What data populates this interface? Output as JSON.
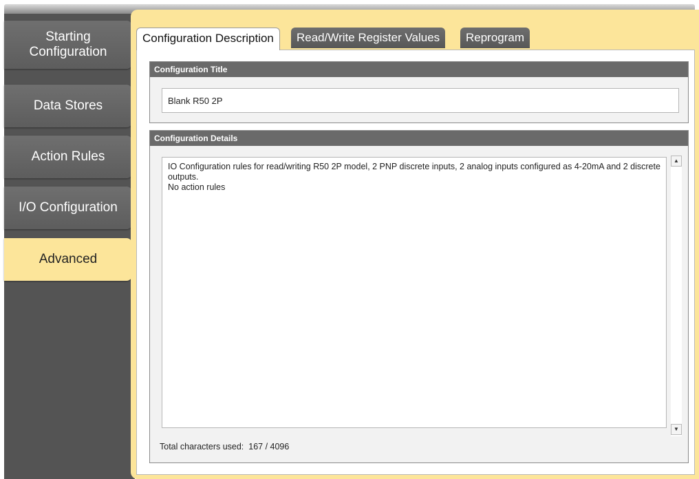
{
  "sidebar": {
    "items": [
      {
        "label": "Starting Configuration",
        "active": false
      },
      {
        "label": "Data Stores",
        "active": false
      },
      {
        "label": "Action Rules",
        "active": false
      },
      {
        "label": "I/O Configuration",
        "active": false
      },
      {
        "label": "Advanced",
        "active": true
      }
    ]
  },
  "tabs": [
    {
      "label": "Configuration Description",
      "active": true
    },
    {
      "label": "Read/Write Register Values",
      "active": false
    },
    {
      "label": "Reprogram",
      "active": false
    }
  ],
  "config_title": {
    "header": "Configuration Title",
    "value": "Blank R50 2P"
  },
  "config_details": {
    "header": "Configuration Details",
    "value": "IO Configuration rules for read/writing R50 2P model, 2 PNP discrete inputs, 2 analog inputs configured as 4-20mA and 2 discrete outputs.\nNo action rules",
    "scroll_up_icon": "triangle-up-icon",
    "scroll_down_icon": "triangle-down-icon",
    "char_count_label": "Total characters used:",
    "char_count_value": "167 / 4096"
  },
  "colors": {
    "accent_yellow": "#fce59a",
    "sidebar_gray": "#545454",
    "button_gray": "#6a6a6a"
  }
}
